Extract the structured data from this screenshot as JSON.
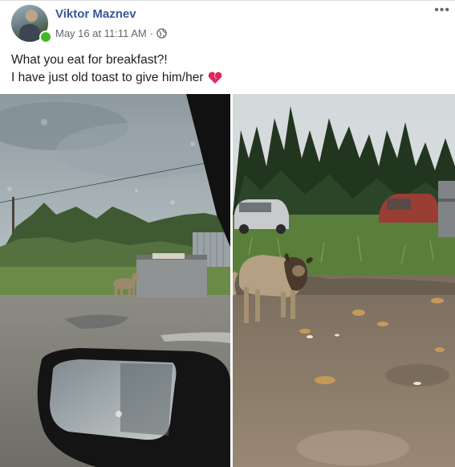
{
  "post": {
    "author": "Viktor Maznev",
    "timestamp": "May 16 at 11:11 AM",
    "separator": "·",
    "more": "•••",
    "text_line1": "What you eat for breakfast?!",
    "text_line2": "I have just old toast to give him/her"
  },
  "icons": {
    "privacy": "globe-icon",
    "emoji": "broken-heart-icon",
    "options": "more-options-icon"
  },
  "colors": {
    "author_link": "#385898",
    "online": "#42b72a",
    "meta": "#606770",
    "broken_heart": "#e0245e"
  }
}
